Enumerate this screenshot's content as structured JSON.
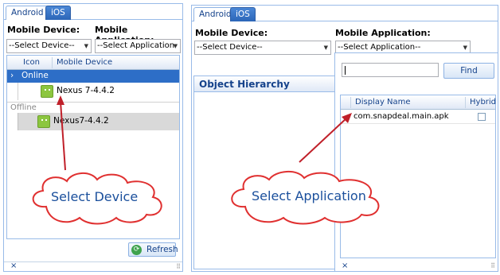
{
  "left_panel": {
    "tabs": [
      {
        "label": "Android"
      },
      {
        "label": "iOS"
      }
    ],
    "mobile_device_label": "Mobile Device:",
    "mobile_application_label": "Mobile Application:",
    "device_combo_value": "--Select Device--",
    "application_combo_value": "--Select Application--",
    "grid": {
      "columns": [
        "Icon",
        "Mobile Device"
      ],
      "group_online": "Online",
      "online_device": "Nexus 7-4.4.2",
      "group_offline": "Offline",
      "offline_device": "Nexus7-4.4.2"
    },
    "refresh_label": "Refresh",
    "close_glyph": "×"
  },
  "right_panel": {
    "tabs": [
      {
        "label": "Android"
      },
      {
        "label": "iOS"
      }
    ],
    "mobile_device_label": "Mobile Device:",
    "mobile_application_label": "Mobile Application:",
    "device_combo_value": "--Select Device--",
    "application_combo_value": "--Select Application--",
    "object_hierarchy_title": "Object Hierarchy",
    "popup": {
      "search_value": "",
      "find_label": "Find",
      "columns": [
        "Display Name",
        "Hybrid"
      ],
      "rows": [
        {
          "display_name": "com.snapdeal.main.apk",
          "hybrid": false
        }
      ],
      "close_glyph": "×"
    }
  },
  "annotations": {
    "select_device": "Select Device",
    "select_application": "Select Application"
  },
  "colors": {
    "accent": "#2d6ec7",
    "tab_active_text": "#15428b",
    "annotation_arrow": "#c0202a",
    "cloud_stroke": "#e03030"
  },
  "icons": [
    "android-icon",
    "expand-arrow-icon",
    "refresh-icon",
    "dropdown-arrow-icon",
    "close-icon",
    "checkbox-icon",
    "grip-icon"
  ]
}
